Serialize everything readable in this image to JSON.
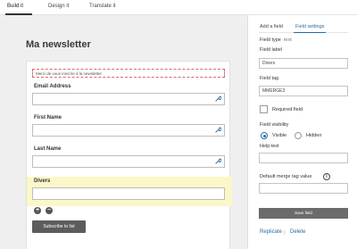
{
  "top_tabs": [
    "Build it",
    "Design it",
    "Translate it"
  ],
  "newsletter_title": "Ma newsletter",
  "intro_text": "Merci de vous inscrire à la newsletter",
  "fields": [
    {
      "label": "Email Address"
    },
    {
      "label": "First Name"
    },
    {
      "label": "Last Name"
    },
    {
      "label": "Divers"
    }
  ],
  "subscribe_label": "Subscribe to list",
  "panel": {
    "tabs": [
      "Add a field",
      "Field settings"
    ],
    "field_type_label": "Field type",
    "field_type_value": "text",
    "field_label_label": "Field label",
    "field_label_value": "Divers",
    "field_tag_label": "Field tag",
    "field_tag_value": "MMERGE3",
    "required_label": "Required field",
    "visibility_label": "Field visibility",
    "visible_label": "Visible",
    "hidden_label": "Hidden",
    "help_text_label": "Help text",
    "help_text_value": "",
    "default_merge_label": "Default merge tag value",
    "default_merge_value": "",
    "save_label": "Save field",
    "replicate_label": "Replicate",
    "delete_label": "Delete"
  },
  "colors": {
    "accent": "#2a6aa0",
    "highlight": "#fbf7c8",
    "canvas_bg": "#efefef",
    "button_dark": "#5c5c5c"
  }
}
